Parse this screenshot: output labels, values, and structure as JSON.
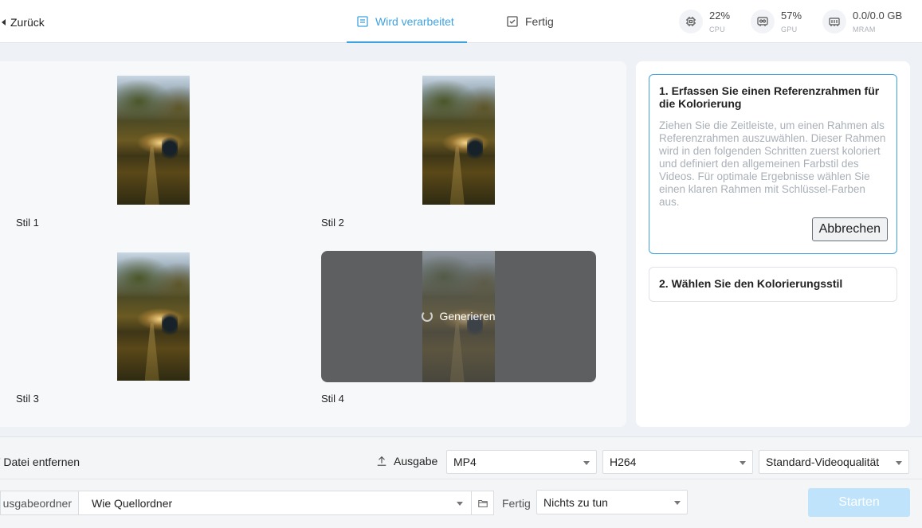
{
  "header": {
    "back_label": "Zurück",
    "tabs": [
      {
        "label": "Wird verarbeitet",
        "icon": "list-icon",
        "active": true
      },
      {
        "label": "Fertig",
        "icon": "checklist-icon",
        "active": false
      }
    ],
    "stats": [
      {
        "value": "22%",
        "label": "CPU",
        "icon": "cpu-icon"
      },
      {
        "value": "57%",
        "label": "GPU",
        "icon": "gpu-icon"
      },
      {
        "value": "0.0/0.0 GB",
        "label": "MRAM",
        "icon": "memory-icon"
      }
    ]
  },
  "styles": [
    {
      "label": "Stil 1"
    },
    {
      "label": "Stil 2"
    },
    {
      "label": "Stil 3"
    },
    {
      "label": "Stil 4",
      "status": "Generieren"
    }
  ],
  "steps": {
    "step1": {
      "title": "1. Erfassen Sie einen Referenzrahmen für die Kolorierung",
      "description": "Ziehen Sie die Zeitleiste, um einen Rahmen als Referenzrahmen auszuwählen. Dieser Rahmen wird in den folgenden Schritten zuerst koloriert und definiert den allgemeinen Farbstil des Videos. Für optimale Ergebnisse wählen Sie einen klaren Rahmen mit Schlüssel-Farben aus.",
      "cancel_label": "Abbrechen"
    },
    "step2": {
      "title": "2. Wählen Sie den Kolorierungsstil"
    }
  },
  "bottom": {
    "remove_label": "Datei entfernen",
    "output_label": "Ausgabe",
    "format": "MP4",
    "codec": "H264",
    "quality": "Standard-Videoqualität",
    "folder_label": "usgabeordner",
    "folder_value": "Wie Quellordner",
    "done_label": "Fertig",
    "done_action": "Nichts zu tun",
    "start_label": "Starten"
  },
  "colors": {
    "accent": "#3fa2e0",
    "start_button": "#bfe3fb",
    "overlay": "#5e5f61"
  }
}
